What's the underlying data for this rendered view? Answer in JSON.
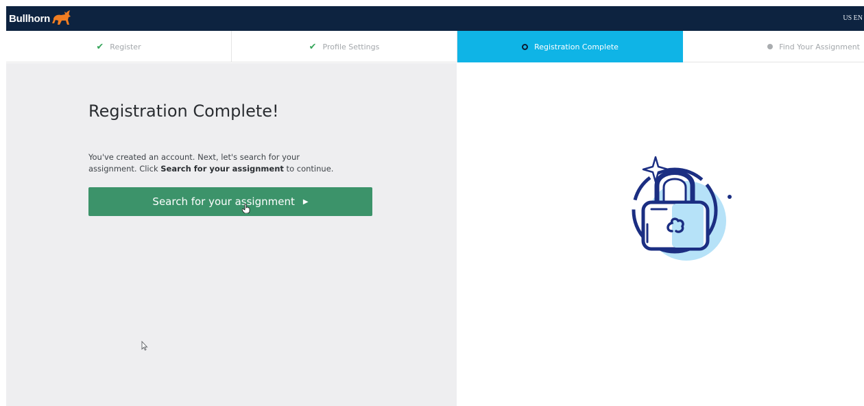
{
  "header": {
    "brand": "Bullhorn",
    "locale": "US EN"
  },
  "steps": [
    {
      "label": "Register",
      "state": "done",
      "icon": "check-icon"
    },
    {
      "label": "Profile Settings",
      "state": "done",
      "icon": "check-icon"
    },
    {
      "label": "Registration Complete",
      "state": "active",
      "icon": "ring-icon"
    },
    {
      "label": "Find Your Assignment",
      "state": "pending",
      "icon": "dot-icon"
    }
  ],
  "main": {
    "title": "Registration Complete!",
    "desc_line1": "You've created an account. Next, let's search for your",
    "desc_prefix": "assignment. Click ",
    "desc_bold": "Search for your assignment",
    "desc_suffix": " to continue.",
    "button_label": "Search for your assignment"
  },
  "illustration": {
    "icon": "padlock-icon"
  },
  "colors": {
    "header_bg": "#0d2340",
    "active_step": "#0fb4e6",
    "button": "#3c936a",
    "check": "#35a55a"
  }
}
